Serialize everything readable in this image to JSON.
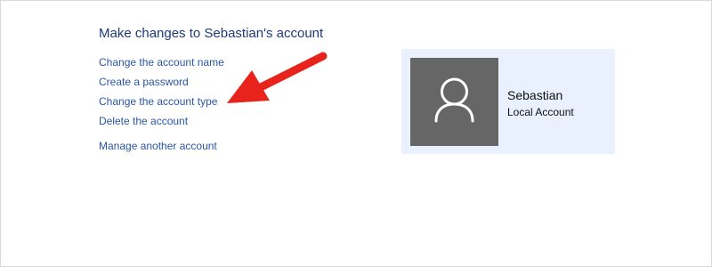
{
  "page": {
    "title": "Make changes to Sebastian's account"
  },
  "tasks": [
    {
      "label": "Change the account name"
    },
    {
      "label": "Create a password"
    },
    {
      "label": "Change the account type"
    },
    {
      "label": "Delete the account"
    },
    {
      "label": "Manage another account"
    }
  ],
  "account": {
    "name": "Sebastian",
    "type": "Local Account",
    "avatar_icon": "user-silhouette-icon"
  },
  "colors": {
    "title": "#1f3a78",
    "link": "#2a56a6",
    "card_background": "#e8f1fd",
    "avatar_background": "#666666",
    "annotation_arrow": "#e8231c"
  }
}
